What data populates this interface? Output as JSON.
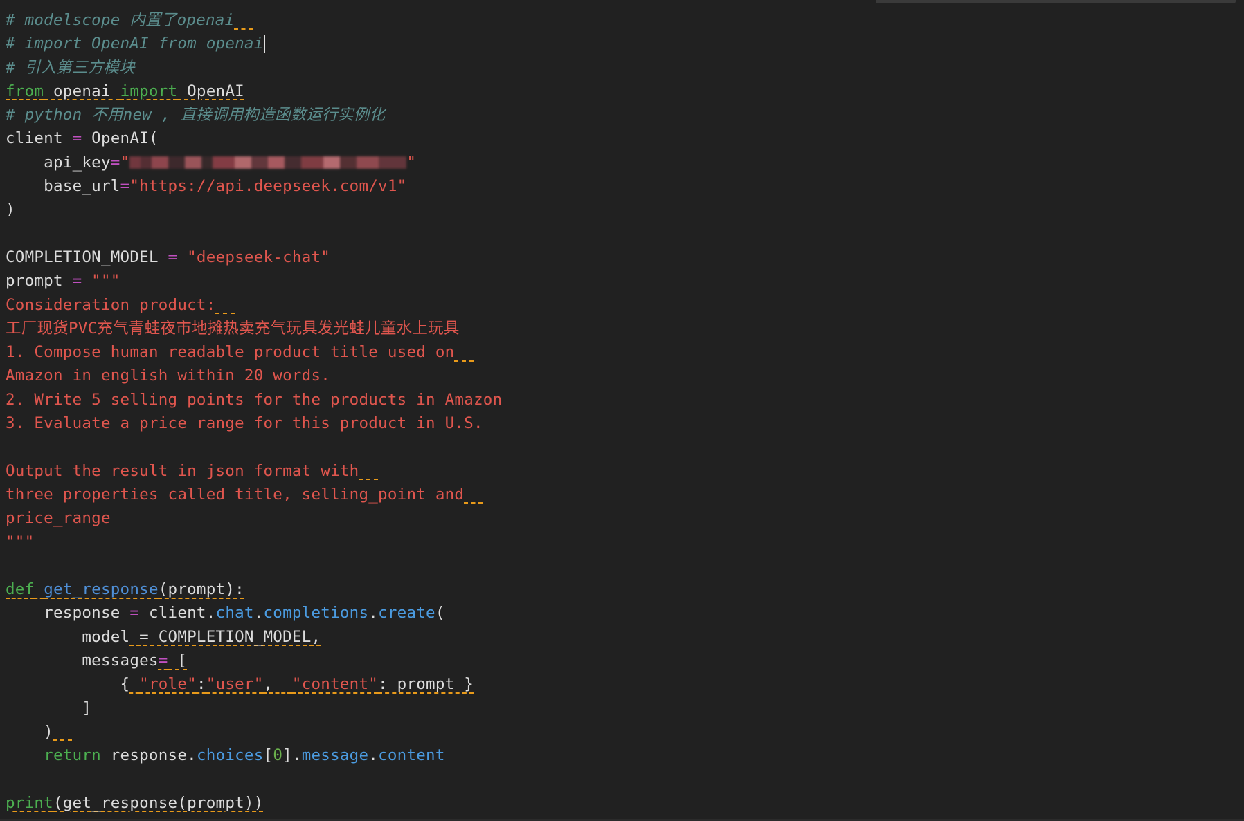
{
  "editor": {
    "lines": [
      [
        {
          "t": "# modelscope 内置了openai",
          "c": "c-comment"
        },
        {
          "t": "  ",
          "c": "c-comment warn"
        }
      ],
      [
        {
          "t": "# import OpenAI from openai",
          "c": "c-comment"
        },
        {
          "caret": true
        }
      ],
      [
        {
          "t": "# 引入第三方模块",
          "c": "c-comment"
        }
      ],
      [
        {
          "t": "from",
          "c": "c-kw warn"
        },
        {
          "t": " openai ",
          "c": "c-ident warn"
        },
        {
          "t": "import",
          "c": "c-kw warn"
        },
        {
          "t": " OpenAI",
          "c": "c-ident warn"
        }
      ],
      [
        {
          "t": "# python 不用new , 直接调用构造函数运行实例化",
          "c": "c-comment"
        }
      ],
      [
        {
          "t": "client ",
          "c": "c-ident"
        },
        {
          "t": "=",
          "c": "c-op"
        },
        {
          "t": " OpenAI(",
          "c": "c-ident"
        }
      ],
      [
        {
          "t": "    api_key",
          "c": "c-ident"
        },
        {
          "t": "=",
          "c": "c-op"
        },
        {
          "t": "\"",
          "c": "c-str"
        },
        {
          "redacted": true
        },
        {
          "t": "\"",
          "c": "c-str"
        }
      ],
      [
        {
          "t": "    base_url",
          "c": "c-ident"
        },
        {
          "t": "=",
          "c": "c-op"
        },
        {
          "t": "\"https://api.deepseek.com/v1\"",
          "c": "c-str"
        }
      ],
      [
        {
          "t": ")",
          "c": "c-ident"
        }
      ],
      [],
      [
        {
          "t": "COMPLETION_MODEL ",
          "c": "c-ident"
        },
        {
          "t": "=",
          "c": "c-op"
        },
        {
          "t": " ",
          "c": "c-ident"
        },
        {
          "t": "\"deepseek-chat\"",
          "c": "c-str"
        }
      ],
      [
        {
          "t": "prompt ",
          "c": "c-ident"
        },
        {
          "t": "=",
          "c": "c-op"
        },
        {
          "t": " ",
          "c": "c-ident"
        },
        {
          "t": "\"\"\"",
          "c": "c-str"
        }
      ],
      [
        {
          "t": "Consideration product:",
          "c": "c-str"
        },
        {
          "t": "  ",
          "c": "c-str warn"
        }
      ],
      [
        {
          "t": "工厂现货PVC充气青蛙夜市地摊热卖充气玩具发光蛙儿童水上玩具",
          "c": "c-str"
        }
      ],
      [
        {
          "t": "1. Compose human readable product title used on",
          "c": "c-str"
        },
        {
          "t": "  ",
          "c": "c-str warn"
        }
      ],
      [
        {
          "t": "Amazon in english within 20 words.",
          "c": "c-str"
        }
      ],
      [
        {
          "t": "2. Write 5 selling points for the products in Amazon",
          "c": "c-str"
        }
      ],
      [
        {
          "t": "3. Evaluate a price range for this product in U.S.",
          "c": "c-str"
        }
      ],
      [],
      [
        {
          "t": "Output the result in json format with",
          "c": "c-str"
        },
        {
          "t": "  ",
          "c": "c-str warn"
        }
      ],
      [
        {
          "t": "three properties called title, selling_point and",
          "c": "c-str"
        },
        {
          "t": "  ",
          "c": "c-str warn"
        }
      ],
      [
        {
          "t": "price_range",
          "c": "c-str"
        }
      ],
      [
        {
          "t": "\"\"\"",
          "c": "c-str"
        }
      ],
      [],
      [
        {
          "t": "def",
          "c": "c-kw warn"
        },
        {
          "t": " ",
          "c": "c-ident warn"
        },
        {
          "t": "get_response",
          "c": "c-fn warn"
        },
        {
          "t": "(prompt):",
          "c": "c-ident warn"
        }
      ],
      [
        {
          "t": "    response ",
          "c": "c-ident"
        },
        {
          "t": "=",
          "c": "c-op"
        },
        {
          "t": " client.",
          "c": "c-ident"
        },
        {
          "t": "chat",
          "c": "c-attr"
        },
        {
          "t": ".",
          "c": "c-ident"
        },
        {
          "t": "completions",
          "c": "c-attr"
        },
        {
          "t": ".",
          "c": "c-ident"
        },
        {
          "t": "create",
          "c": "c-attr"
        },
        {
          "t": "(",
          "c": "c-ident"
        }
      ],
      [
        {
          "t": "        model",
          "c": "c-ident"
        },
        {
          "t": " = COMPLETION_MODEL,",
          "c": "c-ident warn"
        }
      ],
      [
        {
          "t": "        messages",
          "c": "c-ident"
        },
        {
          "t": "=",
          "c": "c-op warn"
        },
        {
          "t": " [",
          "c": "c-ident warn"
        }
      ],
      [
        {
          "t": "            {",
          "c": "c-ident"
        },
        {
          "t": " ",
          "c": "c-ident warn"
        },
        {
          "t": "\"role\"",
          "c": "c-str warn"
        },
        {
          "t": ":",
          "c": "c-ident warn"
        },
        {
          "t": "\"user\"",
          "c": "c-str warn"
        },
        {
          "t": ",  ",
          "c": "c-ident warn"
        },
        {
          "t": "\"content\"",
          "c": "c-str warn"
        },
        {
          "t": ": prompt }",
          "c": "c-ident warn"
        }
      ],
      [
        {
          "t": "        ]",
          "c": "c-ident"
        }
      ],
      [
        {
          "t": "    )",
          "c": "c-ident"
        },
        {
          "t": "  ",
          "c": "c-ident warn"
        }
      ],
      [
        {
          "t": "    ",
          "c": "c-ident"
        },
        {
          "t": "return",
          "c": "c-kw"
        },
        {
          "t": " response.",
          "c": "c-ident"
        },
        {
          "t": "choices",
          "c": "c-attr"
        },
        {
          "t": "[",
          "c": "c-ident"
        },
        {
          "t": "0",
          "c": "c-num"
        },
        {
          "t": "].",
          "c": "c-ident"
        },
        {
          "t": "message",
          "c": "c-attr"
        },
        {
          "t": ".",
          "c": "c-ident"
        },
        {
          "t": "content",
          "c": "c-attr"
        }
      ],
      [],
      [
        {
          "t": "print",
          "c": "c-kw warn"
        },
        {
          "t": "(get_response(prompt))",
          "c": "c-ident warn"
        }
      ]
    ]
  }
}
